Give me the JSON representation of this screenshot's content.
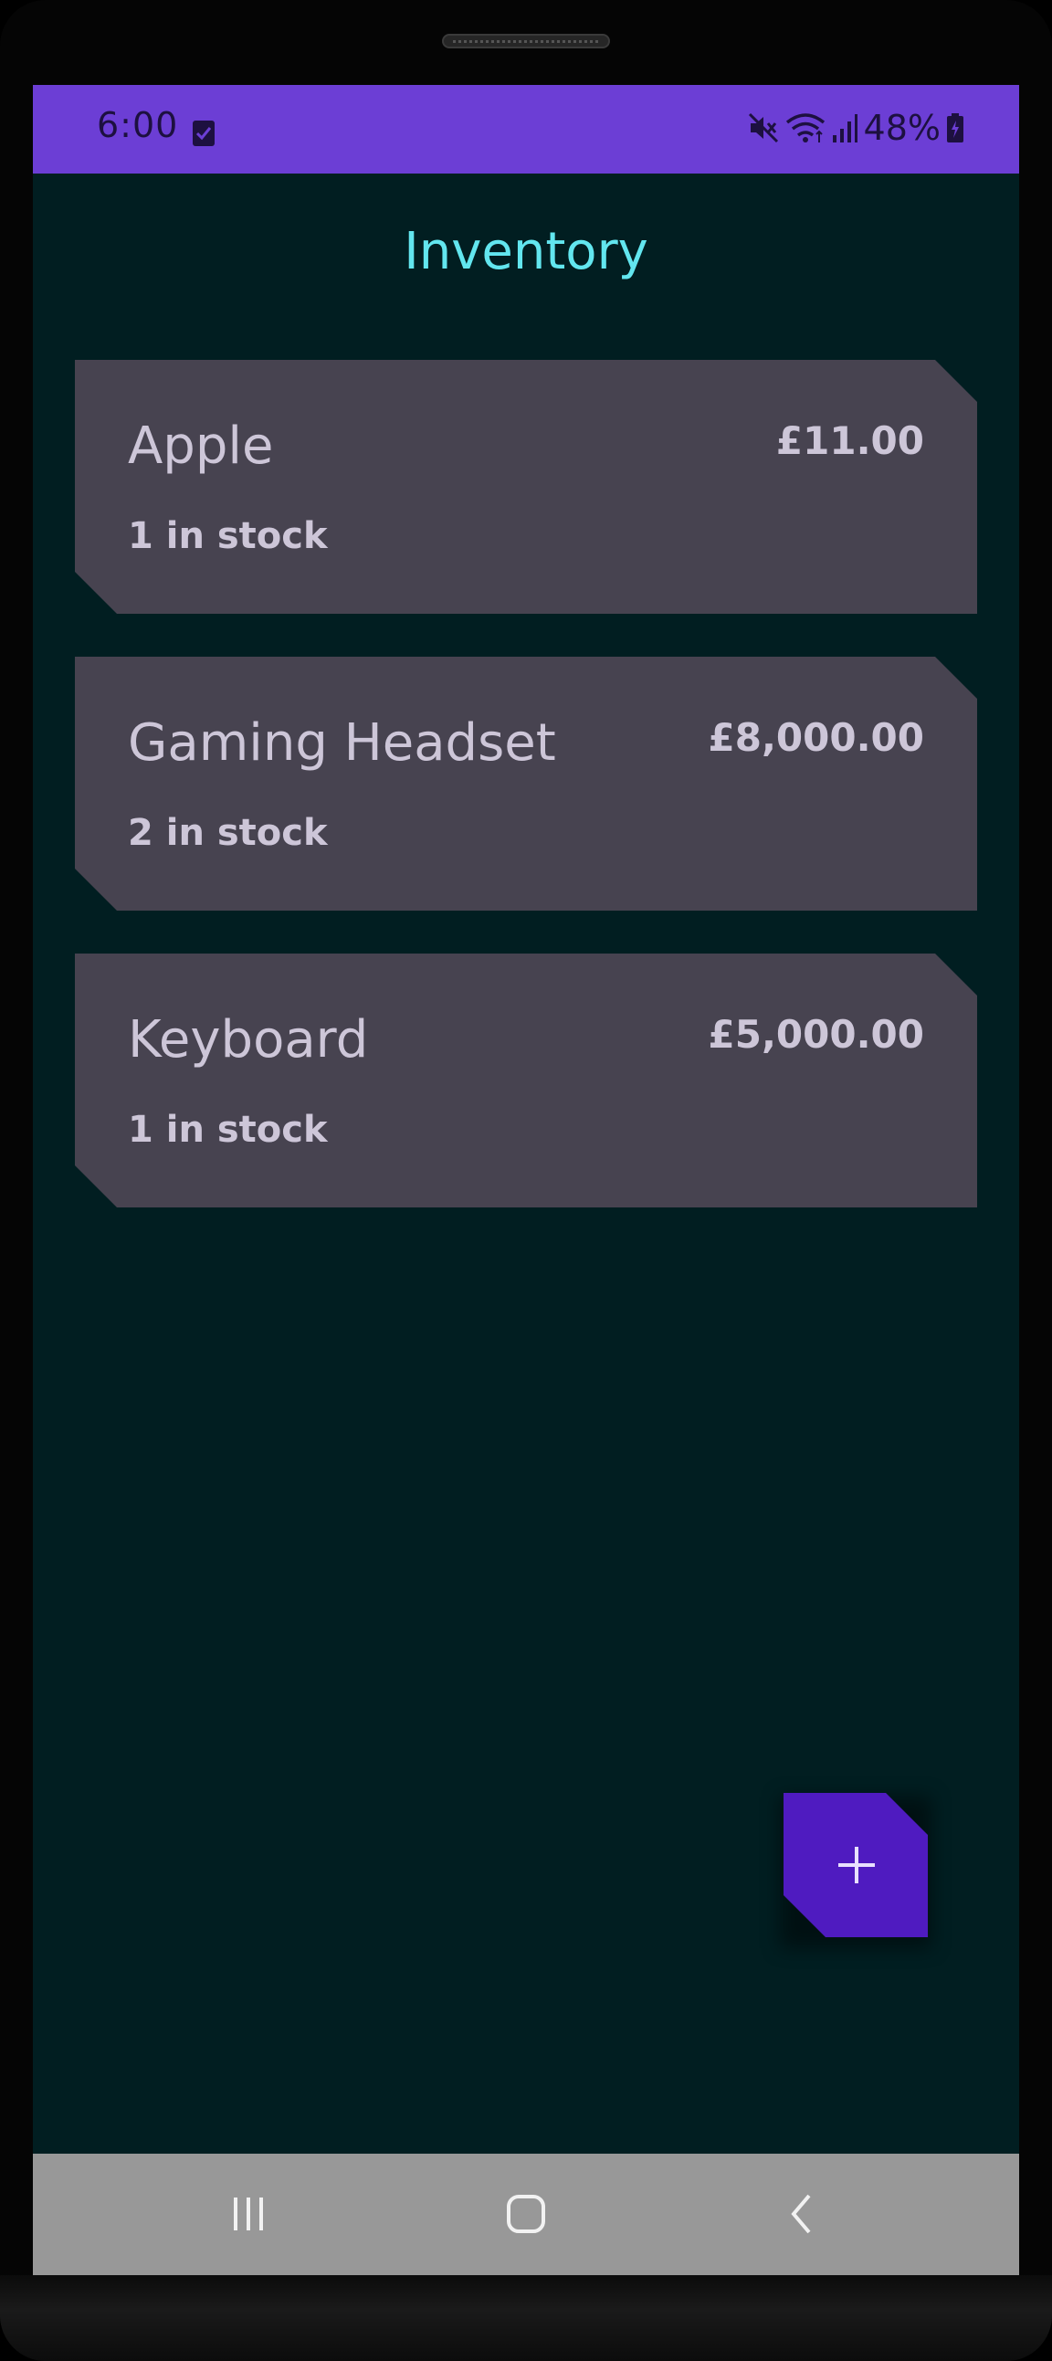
{
  "status_bar": {
    "time": "6:00",
    "battery": "48%",
    "icons": [
      "checkbox-notification-icon",
      "mute-icon",
      "wifi-icon",
      "signal-icon",
      "battery-charging-icon"
    ]
  },
  "app": {
    "title": "Inventory"
  },
  "items": [
    {
      "name": "Apple",
      "price": "£11.00",
      "stock": "1 in stock"
    },
    {
      "name": "Gaming Headset",
      "price": "£8,000.00",
      "stock": "2 in stock"
    },
    {
      "name": "Keyboard",
      "price": "£5,000.00",
      "stock": "1 in stock"
    }
  ],
  "fab": {
    "icon": "plus-icon"
  },
  "nav_bar": {
    "buttons": [
      "recent-apps-icon",
      "home-icon",
      "back-icon"
    ]
  },
  "colors": {
    "status_bar": "#6c3ed5",
    "background": "#011e21",
    "title": "#62e6ef",
    "card": "#474350",
    "card_text": "#cdc6d8",
    "fab": "#4f1bc0",
    "nav_bar": "#989898"
  }
}
